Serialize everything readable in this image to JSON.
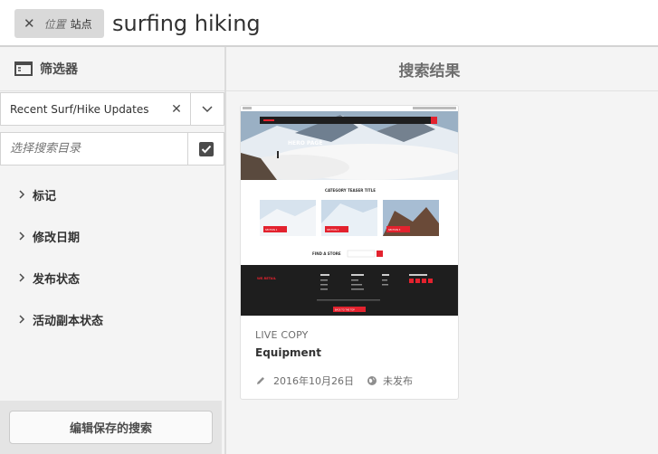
{
  "omnisearch": {
    "tag_prefix": "位置",
    "tag_value": "站点",
    "query": "surfing hiking"
  },
  "filters": {
    "title": "筛选器",
    "saved_search": "Recent Surf/Hike Updates",
    "path_placeholder": "选择搜索目录",
    "sections": [
      "标记",
      "修改日期",
      "发布状态",
      "活动副本状态"
    ],
    "edit_saved_label": "编辑保存的搜索"
  },
  "results": {
    "title": "搜索结果",
    "card": {
      "kind": "LIVE COPY",
      "name": "Equipment",
      "modified": "2016年10月26日",
      "status": "未发布",
      "thumb": {
        "hero_title": "HERO PAGE",
        "teaser_title": "CATEGORY TEASER TITLE",
        "find_store": "FIND A STORE",
        "brand": "WE.RETAIL",
        "btn1": "SECTION 1",
        "btn2": "SECTION 2",
        "btn3": "SECTION 3",
        "to_top": "BACK TO THE TOP"
      }
    }
  },
  "colors": {
    "accent_red": "#e3222e",
    "dark_footer": "#1e1e1e"
  },
  "icons": [
    "close-icon",
    "sidebar-panel-icon",
    "chevron-down-icon",
    "checkbox-icon",
    "chevron-right-icon",
    "pencil-icon",
    "globe-icon"
  ]
}
